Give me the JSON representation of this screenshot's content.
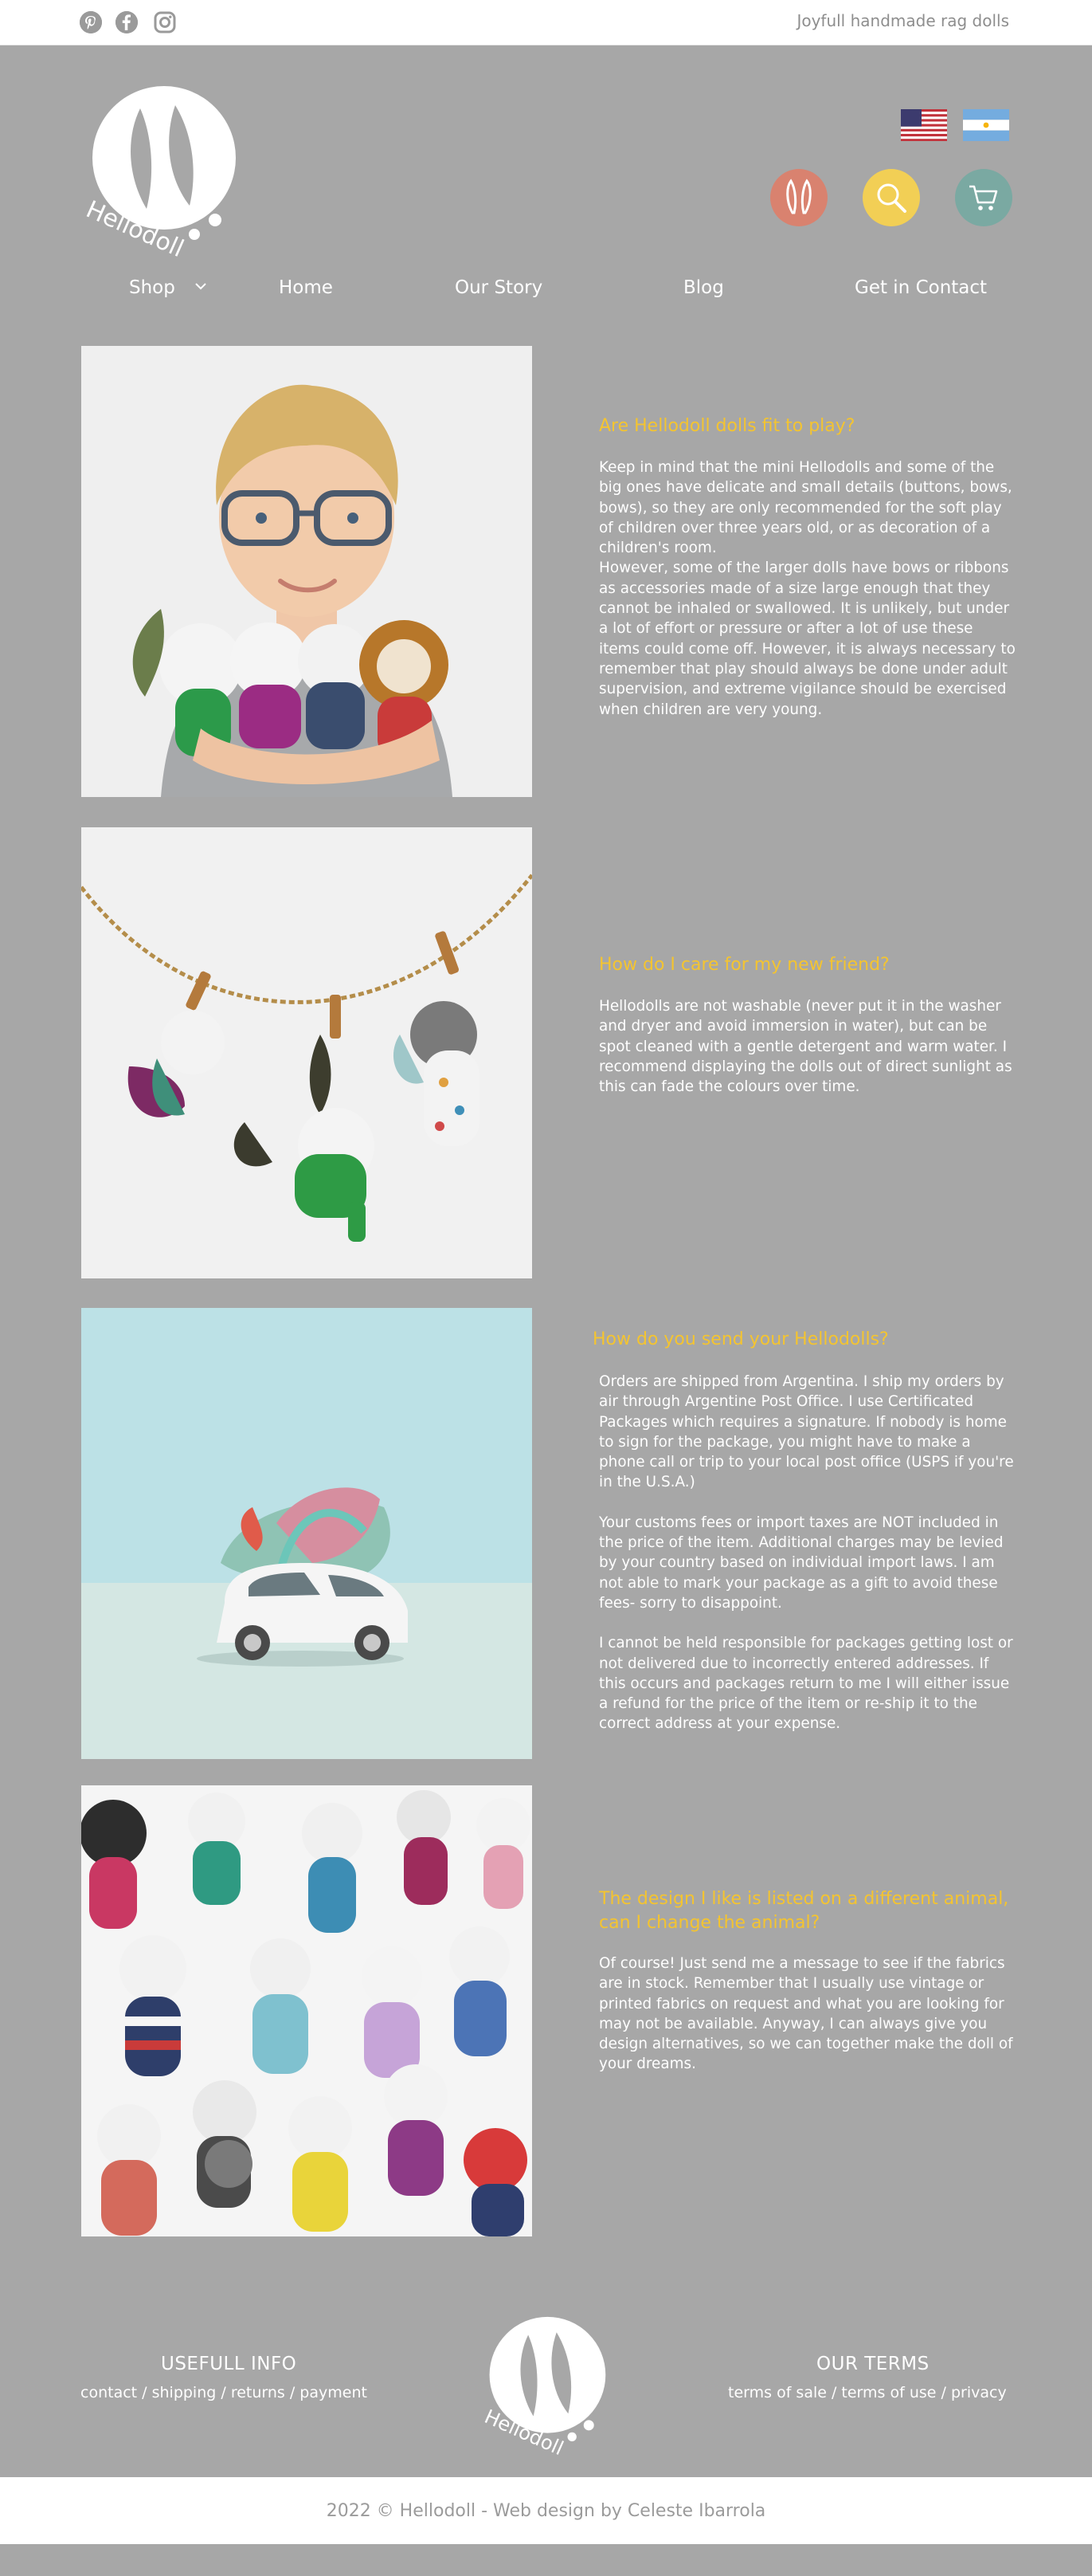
{
  "header": {
    "tagline": "Joyfull handmade rag dolls",
    "social": [
      "pinterest-icon",
      "facebook-icon",
      "instagram-icon"
    ]
  },
  "logo": {
    "text": "Hellodoll"
  },
  "languages": [
    "english-flag",
    "spanish-flag"
  ],
  "actions": [
    "account",
    "search",
    "cart"
  ],
  "colors": {
    "background": "#a7a7a7",
    "accent_yellow": "#f4c430",
    "account_circle": "#d9826f",
    "search_circle": "#f2cf55",
    "cart_circle": "#7aa9a2"
  },
  "nav": {
    "shop": "Shop",
    "home": "Home",
    "story": "Our Story",
    "blog": "Blog",
    "contact": "Get in Contact"
  },
  "faq": [
    {
      "title": "Are Hellodoll dolls fit to play?",
      "paragraphs": [
        "Keep in mind that the mini Hellodolls and some of the big ones have delicate and small details (buttons, bows, bows), so they are only recommended for the soft play of children over three years old, or as decoration of a children's room.",
        "However, some of the larger dolls have bows or ribbons as accessories made of a size large enough that they cannot be inhaled or swallowed. It is unlikely, but under a lot of effort or pressure or after a lot of use these items could come off. However, it is always necessary to remember that play should always be done under adult supervision, and extreme vigilance should be exercised when children are very young."
      ]
    },
    {
      "title": "How do I care for my new friend?",
      "paragraphs": [
        "Hellodolls are not washable (never put it in the washer and dryer and avoid immersion in water), but can be spot cleaned with a gentle detergent and warm water. I recommend displaying the dolls out of direct sunlight as this can fade the colours over time."
      ]
    },
    {
      "title": "How do you send your Hellodolls?",
      "paragraphs": [
        "Orders are shipped from Argentina. I ship my orders by air through Argentine Post Office. I use Certificated Packages which requires a signature. If nobody is home to sign for the package, you might have to make a phone call or trip to your local post office (USPS if you're in the U.S.A.)",
        "Your customs fees or import taxes are NOT included in the price of the item. Additional charges may be levied by your country based on individual import laws. I am not able to mark your package as a gift to avoid these fees- sorry to disappoint.",
        "I cannot be held responsible for packages getting lost or not delivered due to incorrectly entered addresses. If this occurs and packages return to me I will either issue a refund for the price of the item or re-ship it to the correct address at your expense."
      ]
    },
    {
      "title": "The design I like is listed on a different animal, can I change the animal?",
      "paragraphs": [
        "Of course! Just send me a message to see if the fabrics are in stock. Remember that I usually use vintage or printed fabrics on request and what you are looking for may not be available. Anyway, I can always give you design alternatives, so we can together make the doll of your dreams."
      ]
    }
  ],
  "footer": {
    "info_title": "USEFULL INFO",
    "info_links": [
      "contact",
      "shipping",
      "returns",
      "payment"
    ],
    "terms_title": "OUR TERMS",
    "terms_links": [
      "terms of sale",
      "terms of use",
      "privacy"
    ],
    "separator": " / ",
    "copyright": "2022 © Hellodoll - Web design by Celeste Ibarrola"
  }
}
